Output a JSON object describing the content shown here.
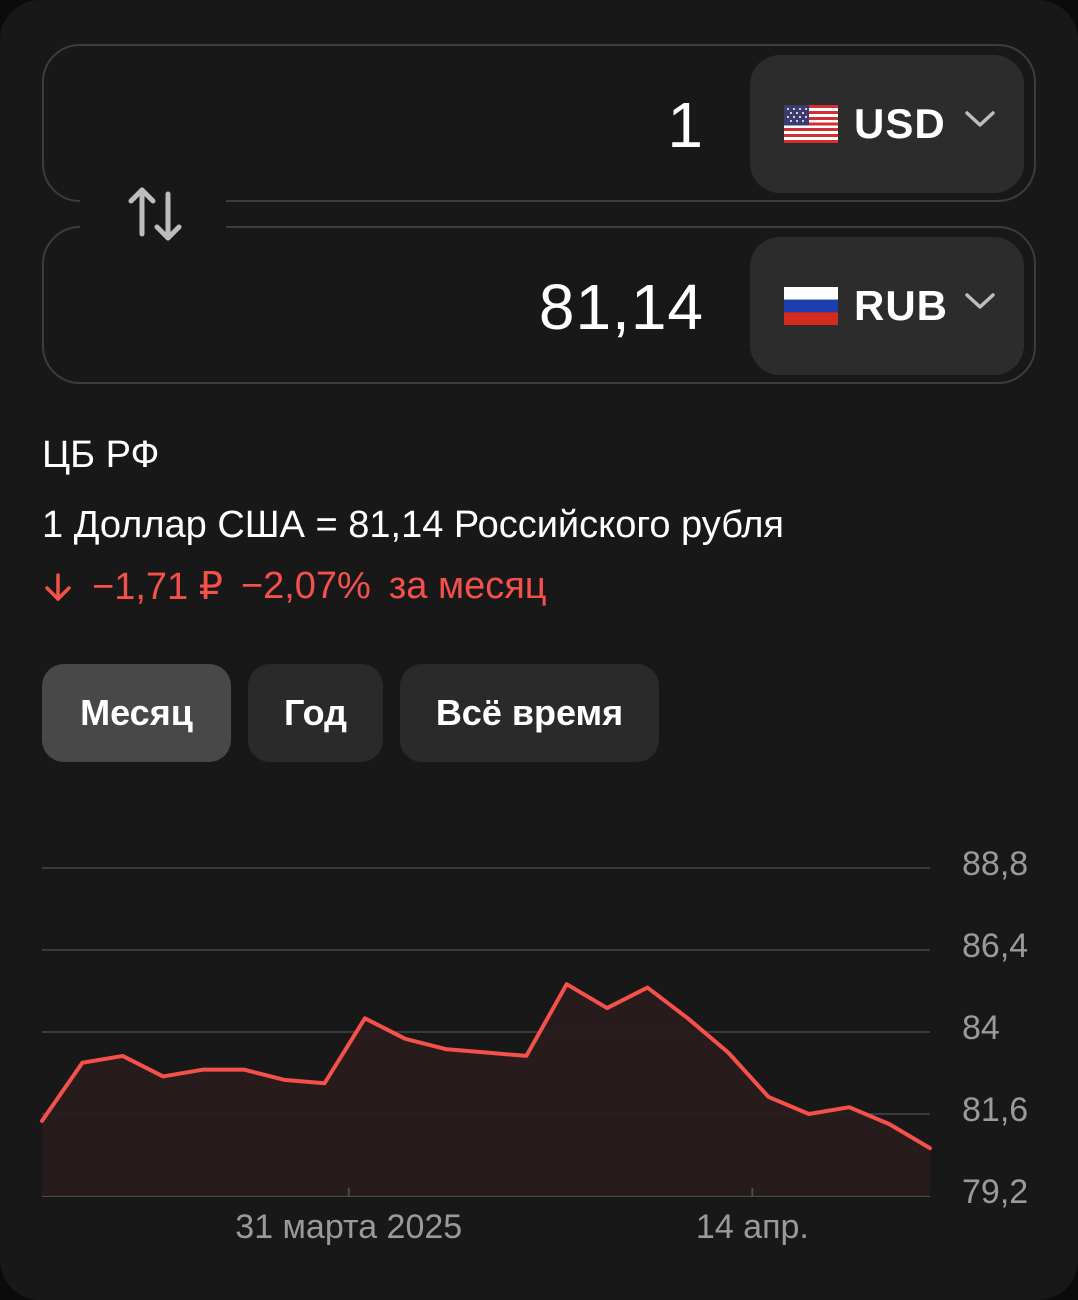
{
  "converter": {
    "from": {
      "amount": "1",
      "code": "USD",
      "flag": "us-flag"
    },
    "to": {
      "amount": "81,14",
      "code": "RUB",
      "flag": "ru-flag"
    }
  },
  "source": "ЦБ РФ",
  "rate_text": "1 Доллар США = 81,14 Российского рубля",
  "change": {
    "abs": "−1,71 ₽",
    "pct": "−2,07%",
    "period": "за месяц",
    "color": "#f4514a"
  },
  "tabs": [
    {
      "label": "Месяц",
      "active": true
    },
    {
      "label": "Год",
      "active": false
    },
    {
      "label": "Всё время",
      "active": false
    }
  ],
  "chart_data": {
    "type": "line",
    "title": "",
    "xlabel": "",
    "ylabel": "",
    "y_ticks": [
      "88,8",
      "86,4",
      "84",
      "81,6",
      "79,2"
    ],
    "ylim": [
      79.2,
      88.8
    ],
    "x_ticks": [
      {
        "label": "31 марта 2025",
        "index": 7.6
      },
      {
        "label": "14 апр.",
        "index": 17.6
      }
    ],
    "series": [
      {
        "color": "#f4514a",
        "values": [
          81.4,
          83.1,
          83.3,
          82.7,
          82.9,
          82.9,
          82.6,
          82.5,
          84.4,
          83.8,
          83.5,
          83.4,
          83.3,
          85.4,
          84.7,
          85.3,
          84.4,
          83.4,
          82.1,
          81.6,
          81.8,
          81.3,
          80.6
        ]
      }
    ]
  }
}
